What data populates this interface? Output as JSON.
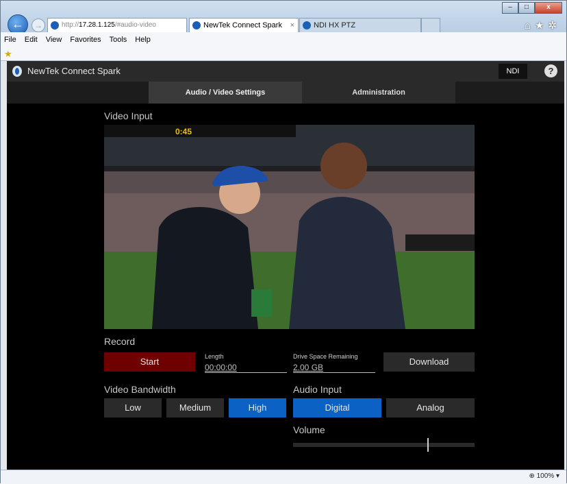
{
  "browser": {
    "address_prefix": "http://",
    "address_host": "17.28.1.125",
    "address_rest": "/#audio-video",
    "address_tools": "⌕ ▾ ↻",
    "tabs": [
      {
        "label": "NewTek Connect Spark",
        "active": true
      },
      {
        "label": "NDI HX PTZ",
        "active": false
      }
    ],
    "tab_close": "×",
    "menu": [
      "File",
      "Edit",
      "View",
      "Favorites",
      "Tools",
      "Help"
    ],
    "zoom": "100%",
    "window_controls": [
      "–",
      "□",
      "x"
    ]
  },
  "app": {
    "title": "NewTek Connect Spark",
    "ndi_label": "NDI",
    "help_label": "?",
    "tabs": [
      "Audio / Video Settings",
      "Administration"
    ]
  },
  "video": {
    "label": "Video Input",
    "overlay_text": "0:45"
  },
  "record": {
    "label": "Record",
    "start_label": "Start",
    "length_label": "Length",
    "length_value": "00:00:00",
    "drive_label": "Drive Space Remaining",
    "drive_value": "2.00 GB",
    "download_label": "Download"
  },
  "bandwidth": {
    "label": "Video Bandwidth",
    "options": [
      "Low",
      "Medium",
      "High"
    ],
    "selected": "High"
  },
  "audio": {
    "label": "Audio Input",
    "options": [
      "Digital",
      "Analog"
    ],
    "selected": "Digital"
  },
  "volume": {
    "label": "Volume",
    "level": 0.74
  },
  "colors": {
    "accent": "#0b61c4",
    "record": "#6e0000",
    "panel": "#2a2a2a"
  }
}
